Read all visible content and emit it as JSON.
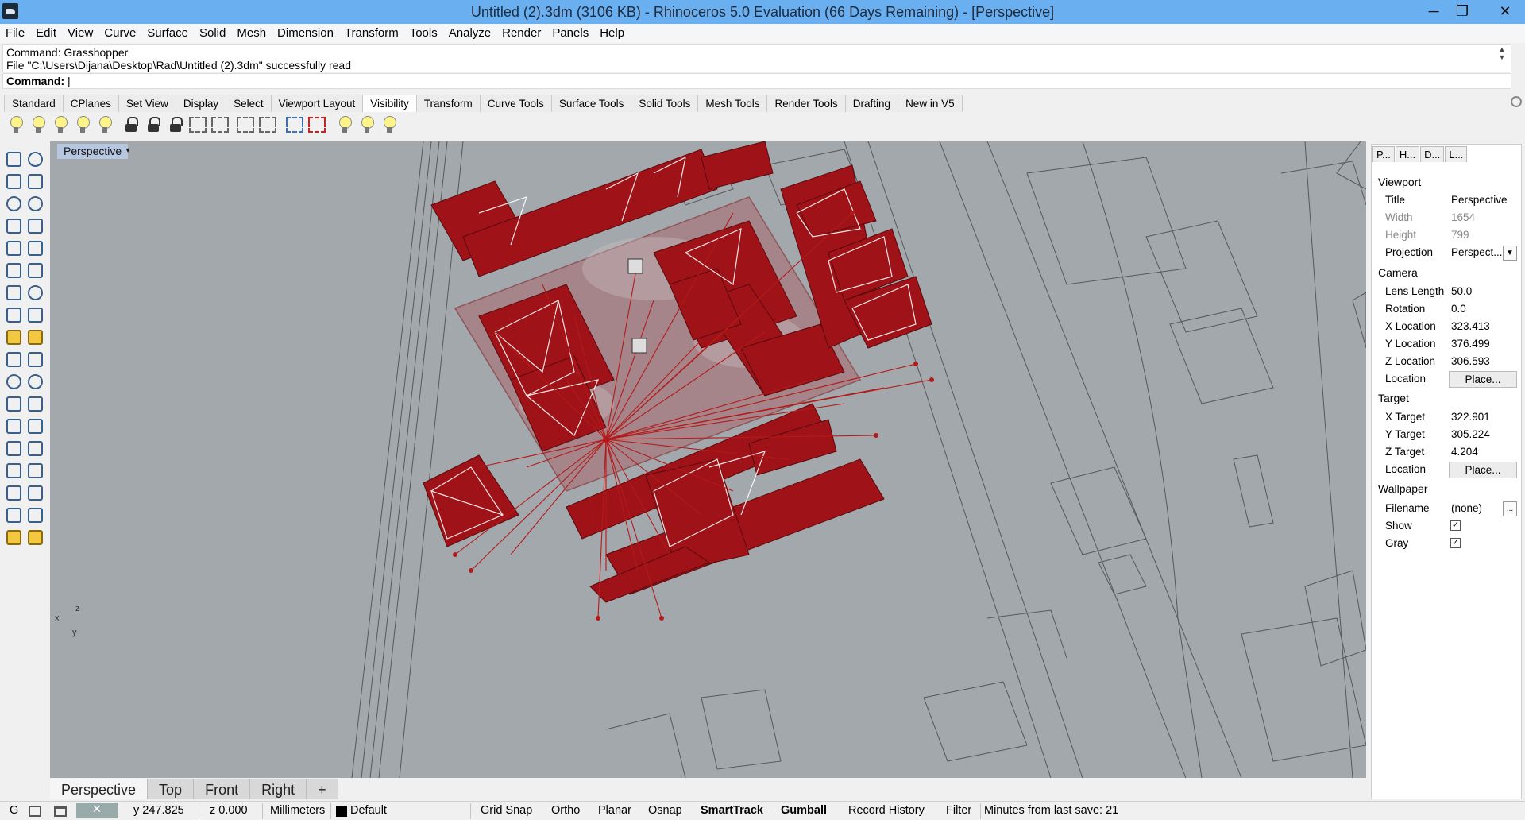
{
  "window": {
    "title": "Untitled (2).3dm (3106 KB) - Rhinoceros 5.0 Evaluation (66 Days Remaining) - [Perspective]",
    "minimize": "─",
    "maximize": "❐",
    "close": "✕"
  },
  "menu": [
    "File",
    "Edit",
    "View",
    "Curve",
    "Surface",
    "Solid",
    "Mesh",
    "Dimension",
    "Transform",
    "Tools",
    "Analyze",
    "Render",
    "Panels",
    "Help"
  ],
  "command": {
    "history_line1": "Command: Grasshopper",
    "history_line2": "File \"C:\\Users\\Dijana\\Desktop\\Rad\\Untitled (2).3dm\" successfully read",
    "prompt": "Command:"
  },
  "toolbar_tabs": [
    "Standard",
    "CPlanes",
    "Set View",
    "Display",
    "Select",
    "Viewport Layout",
    "Visibility",
    "Transform",
    "Curve Tools",
    "Surface Tools",
    "Solid Tools",
    "Mesh Tools",
    "Render Tools",
    "Drafting",
    "New in V5"
  ],
  "active_toolbar_tab": "Visibility",
  "viewport": {
    "label": "Perspective",
    "dropdown": "▾"
  },
  "view_tabs": [
    "Perspective",
    "Top",
    "Front",
    "Right",
    "+"
  ],
  "panel_tabs": [
    "P...",
    "H...",
    "D...",
    "L..."
  ],
  "properties": {
    "viewport_heading": "Viewport",
    "title_label": "Title",
    "title_value": "Perspective",
    "width_label": "Width",
    "width_value": "1654",
    "height_label": "Height",
    "height_value": "799",
    "projection_label": "Projection",
    "projection_value": "Perspect...",
    "camera_heading": "Camera",
    "lens_label": "Lens Length",
    "lens_value": "50.0",
    "rotation_label": "Rotation",
    "rotation_value": "0.0",
    "xloc_label": "X Location",
    "xloc_value": "323.413",
    "yloc_label": "Y Location",
    "yloc_value": "376.499",
    "zloc_label": "Z Location",
    "zloc_value": "306.593",
    "loc_label": "Location",
    "loc_button": "Place...",
    "target_heading": "Target",
    "xt_label": "X Target",
    "xt_value": "322.901",
    "yt_label": "Y Target",
    "yt_value": "305.224",
    "zt_label": "Z Target",
    "zt_value": "4.204",
    "tloc_label": "Location",
    "tloc_button": "Place...",
    "wallpaper_heading": "Wallpaper",
    "filename_label": "Filename",
    "filename_value": "(none)",
    "filename_button": "...",
    "show_label": "Show",
    "gray_label": "Gray",
    "check": "✓"
  },
  "status": {
    "cplane": "G",
    "y": "y 247.825",
    "z": "z 0.000",
    "units": "Millimeters",
    "layer": "Default",
    "grid_snap": "Grid Snap",
    "ortho": "Ortho",
    "planar": "Planar",
    "osnap": "Osnap",
    "smarttrack": "SmartTrack",
    "gumball": "Gumball",
    "record_history": "Record History",
    "filter": "Filter",
    "minutes": "Minutes from last save: 21"
  },
  "axis": {
    "x": "x",
    "y": "y",
    "z": "z"
  },
  "colors": {
    "titlebar": "#6aaff0",
    "viewport_bg": "#a3a8ad",
    "building": "#9e1218",
    "line": "#b51a1a"
  }
}
